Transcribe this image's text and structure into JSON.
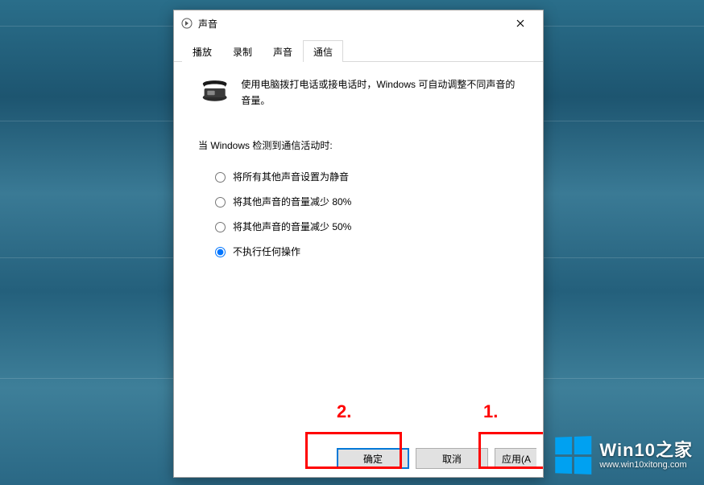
{
  "dialog": {
    "title": "声音",
    "close_label": "关闭"
  },
  "tabs": [
    {
      "label": "播放",
      "active": false
    },
    {
      "label": "录制",
      "active": false
    },
    {
      "label": "声音",
      "active": false
    },
    {
      "label": "通信",
      "active": true
    }
  ],
  "description": "使用电脑拨打电话或接电话时，Windows 可自动调整不同声音的音量。",
  "prompt": "当 Windows 检测到通信活动时:",
  "options": [
    {
      "label": "将所有其他声音设置为静音",
      "selected": false
    },
    {
      "label": "将其他声音的音量减少 80%",
      "selected": false
    },
    {
      "label": "将其他声音的音量减少 50%",
      "selected": false
    },
    {
      "label": "不执行任何操作",
      "selected": true
    }
  ],
  "buttons": {
    "ok": "确定",
    "cancel": "取消",
    "apply": "应用(A"
  },
  "annotations": {
    "one": "1.",
    "two": "2."
  },
  "watermark": {
    "title": "Win10之家",
    "subtitle": "www.win10xitong.com"
  }
}
